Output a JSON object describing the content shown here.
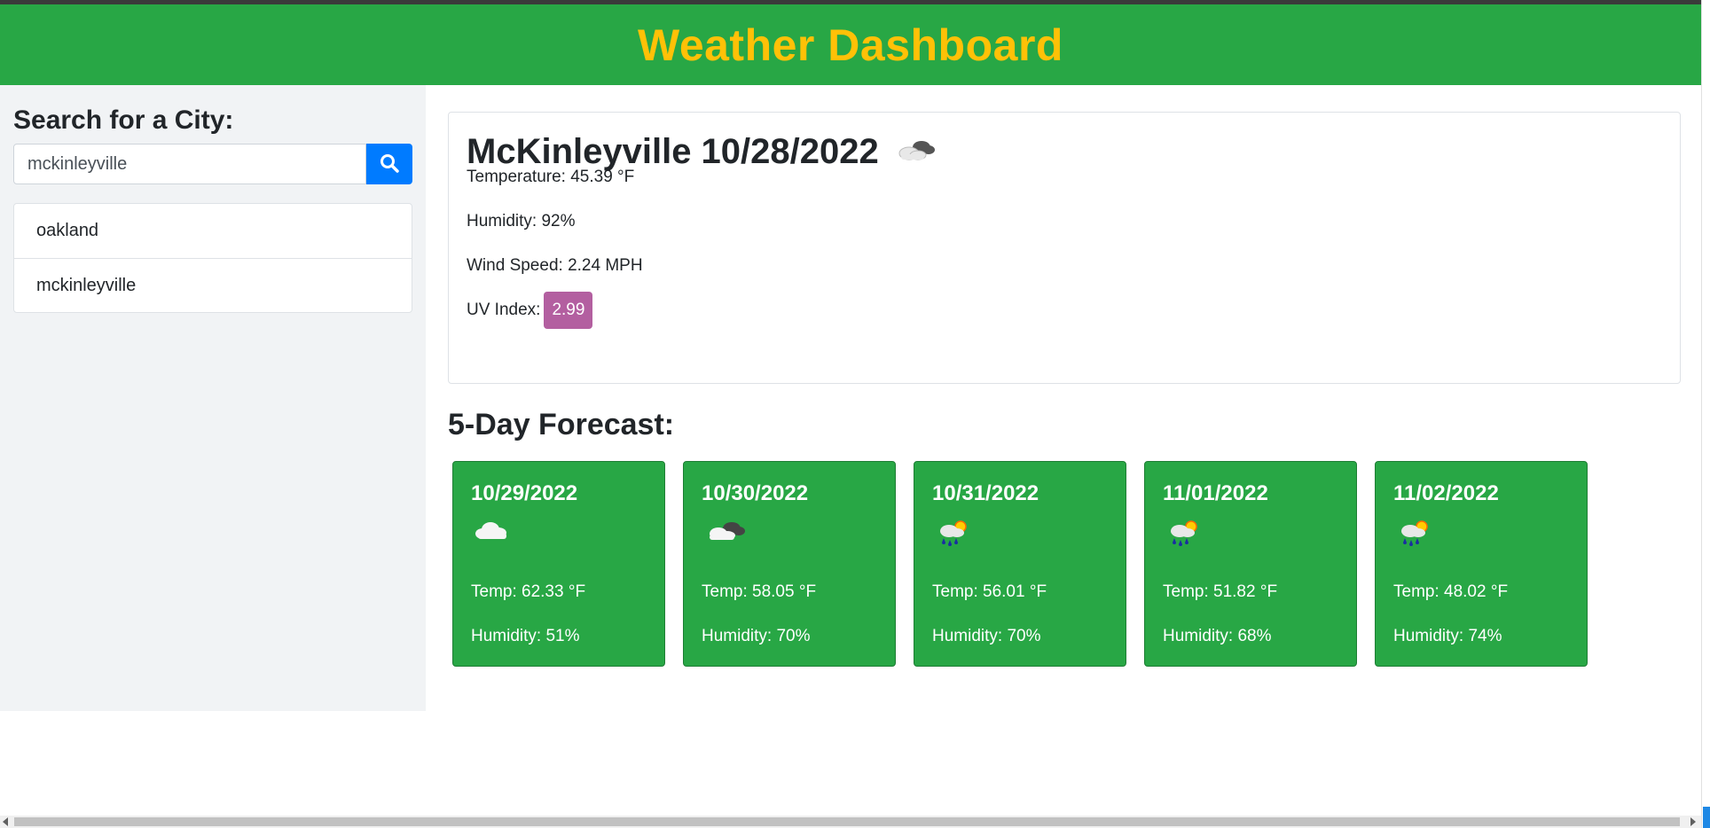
{
  "header": {
    "title": "Weather Dashboard"
  },
  "sidebar": {
    "heading": "Search for a City:",
    "search_value": "mckinleyville",
    "search_icon": "search-icon",
    "history": [
      {
        "label": "oakland"
      },
      {
        "label": "mckinleyville"
      }
    ]
  },
  "current": {
    "title": "McKinleyville 10/28/2022",
    "icon": "cloudy-icon",
    "temperature": "Temperature: 45.39 °F",
    "humidity": "Humidity: 92%",
    "wind": "Wind Speed: 2.24 MPH",
    "uv_label": "UV Index:",
    "uv_value": "2.99",
    "uv_color": "#b35fa0"
  },
  "forecast": {
    "title": "5-Day Forecast:",
    "days": [
      {
        "date": "10/29/2022",
        "icon": "cloud-icon",
        "temp": "Temp: 62.33 °F",
        "humidity": "Humidity: 51%"
      },
      {
        "date": "10/30/2022",
        "icon": "overcast-cloud-icon",
        "temp": "Temp: 58.05 °F",
        "humidity": "Humidity: 70%"
      },
      {
        "date": "10/31/2022",
        "icon": "sun-rain-icon",
        "temp": "Temp: 56.01 °F",
        "humidity": "Humidity: 70%"
      },
      {
        "date": "11/01/2022",
        "icon": "sun-rain-icon",
        "temp": "Temp: 51.82 °F",
        "humidity": "Humidity: 68%"
      },
      {
        "date": "11/02/2022",
        "icon": "sun-rain-icon",
        "temp": "Temp: 48.02 °F",
        "humidity": "Humidity: 74%"
      }
    ]
  },
  "colors": {
    "header_bg": "#28a745",
    "title": "#ffc107",
    "card_bg": "#28a745",
    "button": "#007bff"
  }
}
